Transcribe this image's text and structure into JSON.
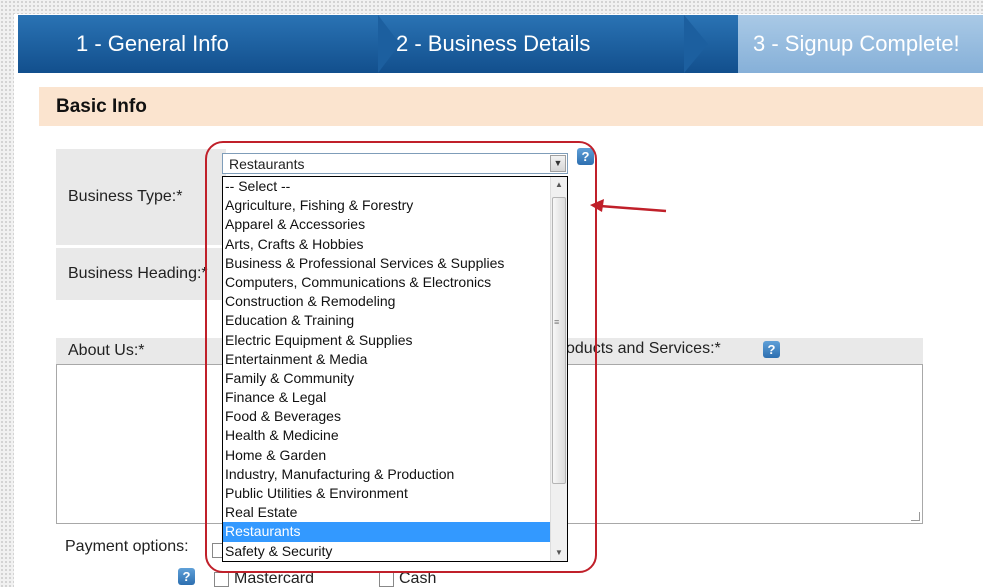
{
  "wizard": {
    "steps": [
      {
        "label": "1 - General Info"
      },
      {
        "label": "2 - Business Details"
      },
      {
        "label": "3 - Signup Complete!"
      }
    ]
  },
  "section": {
    "title": "Basic Info"
  },
  "form": {
    "business_type_label": "Business Type:*",
    "business_heading_label": "Business Heading:*",
    "about_us_label": "About Us:*",
    "products_services_label": "oducts and Services:*",
    "payment_options_label": "Payment options:",
    "help_icon_text": "?",
    "checkbox_mastercard": "Mastercard",
    "checkbox_cash": "Cash"
  },
  "dropdown": {
    "selected_value": "Restaurants",
    "options": [
      "-- Select --",
      "Agriculture, Fishing & Forestry",
      "Apparel & Accessories",
      "Arts, Crafts & Hobbies",
      "Business & Professional Services & Supplies",
      "Computers, Communications & Electronics",
      "Construction & Remodeling",
      "Education & Training",
      "Electric Equipment & Supplies",
      "Entertainment & Media",
      "Family & Community",
      "Finance & Legal",
      "Food & Beverages",
      "Health & Medicine",
      "Home & Garden",
      "Industry, Manufacturing & Production",
      "Public Utilities & Environment",
      "Real Estate",
      "Restaurants",
      "Safety & Security"
    ],
    "highlighted_index": 18
  },
  "colors": {
    "step_active": "#1c5f9f",
    "step_inactive": "#97bde0",
    "section_header_bg": "#fbe4cf",
    "highlight": "#3399ff",
    "callout": "#c0202a"
  }
}
